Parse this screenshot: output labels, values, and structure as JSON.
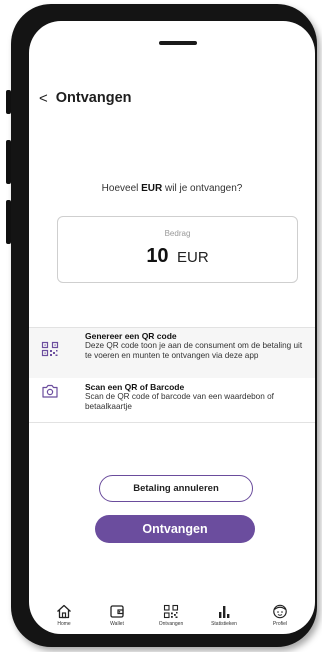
{
  "header": {
    "back_glyph": "<",
    "title": "Ontvangen"
  },
  "question": {
    "prefix": "Hoeveel ",
    "currency": "EUR",
    "suffix": " wil je ontvangen?"
  },
  "amount": {
    "label": "Bedrag",
    "value": "10",
    "currency": "EUR"
  },
  "options": [
    {
      "icon": "qr-code-icon",
      "title": "Genereer een QR code",
      "description": "Deze QR code toon je aan de consument om de betaling uit te voeren en munten te ontvangen via deze app"
    },
    {
      "icon": "camera-icon",
      "title": "Scan een QR of Barcode",
      "description": "Scan de QR code of barcode van een waardebon of betaalkaartje"
    }
  ],
  "buttons": {
    "cancel_label": "Betaling annuleren",
    "primary_label": "Ontvangen"
  },
  "tabs": [
    {
      "icon": "home-icon",
      "label": "Home"
    },
    {
      "icon": "wallet-icon",
      "label": "Wallet"
    },
    {
      "icon": "qr-code-icon",
      "label": "Ontvangen"
    },
    {
      "icon": "bar-chart-icon",
      "label": "Statistieken"
    },
    {
      "icon": "profile-icon",
      "label": "Profiel"
    }
  ],
  "colors": {
    "accent": "#6b4d9e",
    "phone_frame": "#141414",
    "option_bg": "#f6f6f6"
  }
}
